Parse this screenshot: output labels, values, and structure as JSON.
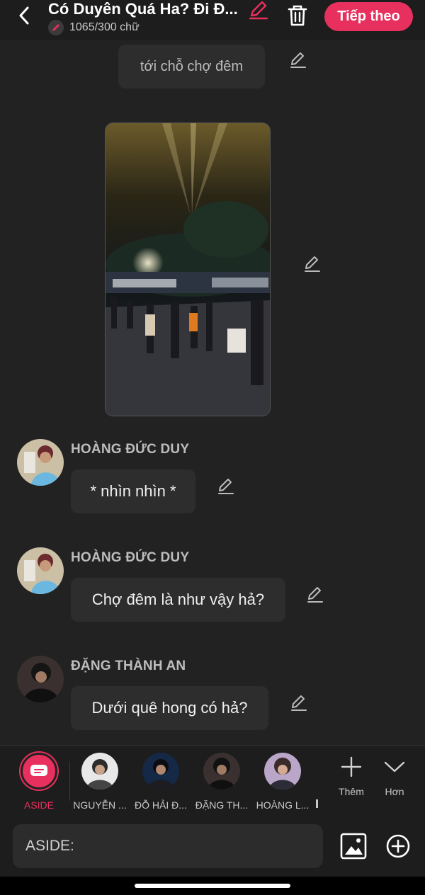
{
  "header": {
    "title": "Có Duyên Quá Ha? Đi Đ...",
    "word_count": "1065/300 chữ",
    "next_label": "Tiếp theo",
    "accent": "#e7305d"
  },
  "chat": {
    "top_bubble": "tới chỗ chợ đêm",
    "messages": [
      {
        "name": "HOÀNG ĐỨC DUY",
        "text": "* nhìn nhìn *"
      },
      {
        "name": "HOÀNG ĐỨC DUY",
        "text": "Chợ đêm là như vậy hả?"
      },
      {
        "name": "ĐẶNG THÀNH AN",
        "text": "Dưới quê hong có hả?"
      }
    ],
    "photo_sign": "BÁNH TRÁNG NƯỚNG"
  },
  "characters": [
    {
      "label": "ASIDE"
    },
    {
      "label": "NGUYỄN ..."
    },
    {
      "label": "ĐỖ HẢI Đ..."
    },
    {
      "label": "ĐẶNG TH..."
    },
    {
      "label": "HOÀNG L..."
    }
  ],
  "actions": {
    "add_label": "Thêm",
    "more_label": "Hơn"
  },
  "input": {
    "placeholder": "ASIDE:"
  }
}
